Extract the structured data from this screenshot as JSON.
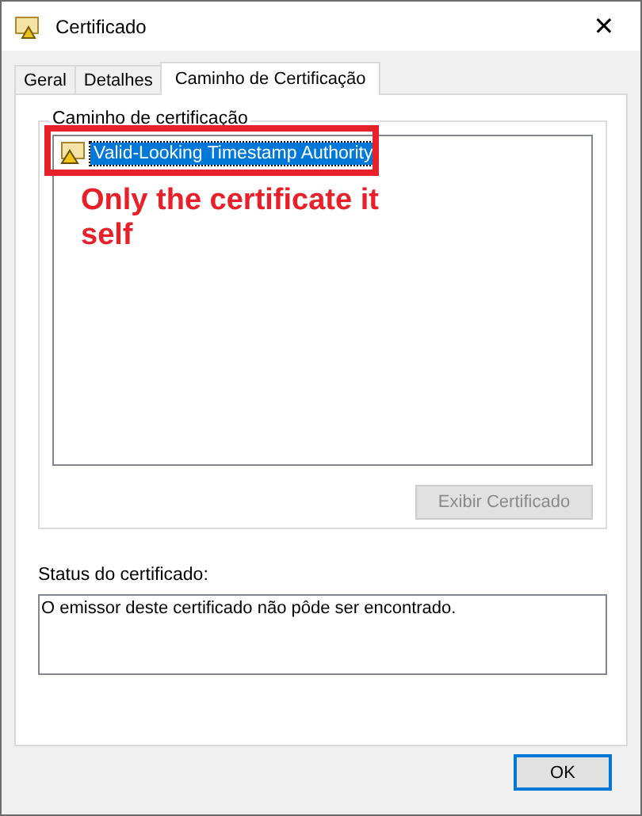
{
  "window": {
    "title": "Certificado",
    "close": "✕"
  },
  "tabs": [
    {
      "label": "Geral",
      "selected": false
    },
    {
      "label": "Detalhes",
      "selected": false
    },
    {
      "label": "Caminho de Certificação",
      "selected": true
    }
  ],
  "path_group": {
    "title": "Caminho de certificação",
    "items": [
      {
        "label": "Valid-Looking Timestamp Authority",
        "selected": true
      }
    ],
    "view_button": {
      "label": "Exibir Certificado",
      "disabled": true
    }
  },
  "annotation": {
    "text": "Only the certificate it self"
  },
  "status": {
    "label": "Status do certificado:",
    "value": "O emissor deste certificado não pôde ser encontrado."
  },
  "buttons": [
    {
      "label": "OK",
      "default": true
    }
  ]
}
